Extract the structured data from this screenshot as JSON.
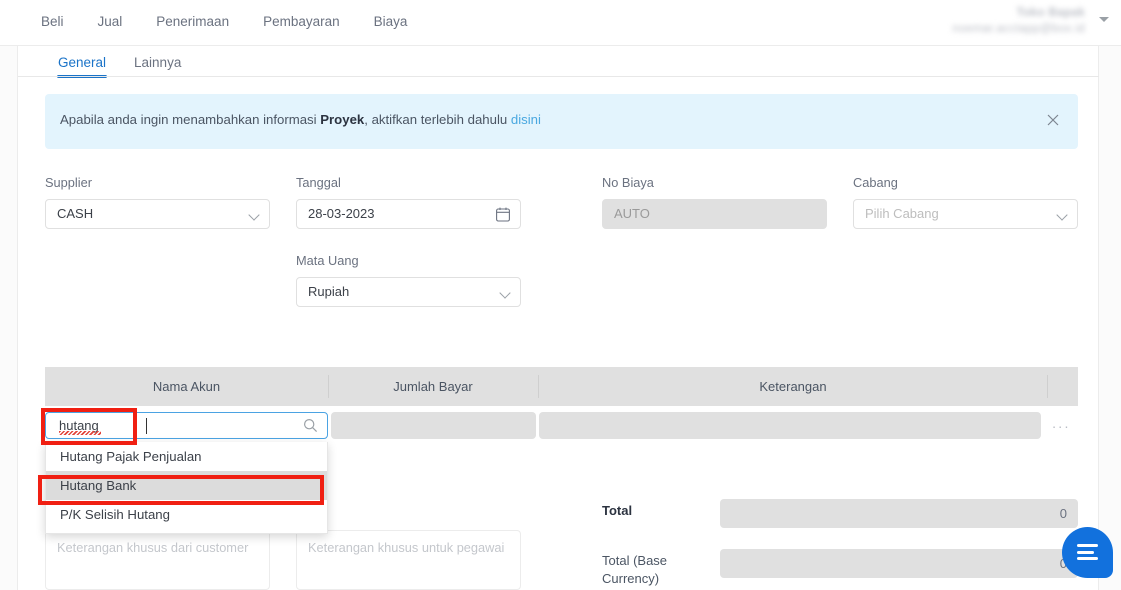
{
  "topnav": {
    "items": [
      {
        "label": "Beli"
      },
      {
        "label": "Jual"
      },
      {
        "label": "Penerimaan"
      },
      {
        "label": "Pembayaran"
      },
      {
        "label": "Biaya"
      }
    ],
    "user": {
      "name": "Toko Bapak",
      "email": "noemar.acctapp@box.id"
    }
  },
  "tabs": [
    {
      "label": "General",
      "active": true
    },
    {
      "label": "Lainnya",
      "active": false
    }
  ],
  "banner": {
    "text_before": "Apabila anda ingin menambahkan informasi ",
    "bold": "Proyek",
    "text_after": ", aktifkan terlebih dahulu ",
    "link": "disini",
    "close_icon": "close-icon",
    "bg_color": "#e3f4fd",
    "link_color": "#4aa8e0"
  },
  "form": {
    "supplier": {
      "label": "Supplier",
      "value": "CASH"
    },
    "tanggal": {
      "label": "Tanggal",
      "value": "28-03-2023",
      "icon": "calendar-icon"
    },
    "no_biaya": {
      "label": "No Biaya",
      "placeholder": "AUTO",
      "disabled": true
    },
    "cabang": {
      "label": "Cabang",
      "placeholder": "Pilih Cabang"
    },
    "mata_uang": {
      "label": "Mata Uang",
      "value": "Rupiah"
    }
  },
  "table": {
    "headers": [
      {
        "label": "Nama Akun"
      },
      {
        "label": "Jumlah Bayar"
      },
      {
        "label": "Keterangan"
      }
    ],
    "row": {
      "nama_akun_value": "hutang",
      "search_icon": "search-icon",
      "jumlah_bayar_value": "",
      "keterangan_value": "",
      "more_actions": "···"
    },
    "header_bg": "#e0e0e0"
  },
  "dropdown": {
    "options": [
      {
        "label": "Hutang Pajak Penjualan",
        "selected": false
      },
      {
        "label": "Hutang Bank",
        "selected": true
      },
      {
        "label": "P/K Selisih Hutang",
        "selected": false
      }
    ]
  },
  "notes": {
    "customer_placeholder": "Keterangan khusus dari customer",
    "employee_placeholder": "Keterangan khusus untuk pegawai"
  },
  "totals": [
    {
      "label": "Total",
      "value": "0",
      "bold": true
    },
    {
      "label": "Total (Base Currency)",
      "value": "0",
      "bold": false
    }
  ],
  "chat": {
    "icon": "chat-bubble-icon",
    "color": "#1271dd"
  },
  "annotations": {
    "input_highlight_color": "#f01f12",
    "option_highlight_color": "#f01f12"
  }
}
